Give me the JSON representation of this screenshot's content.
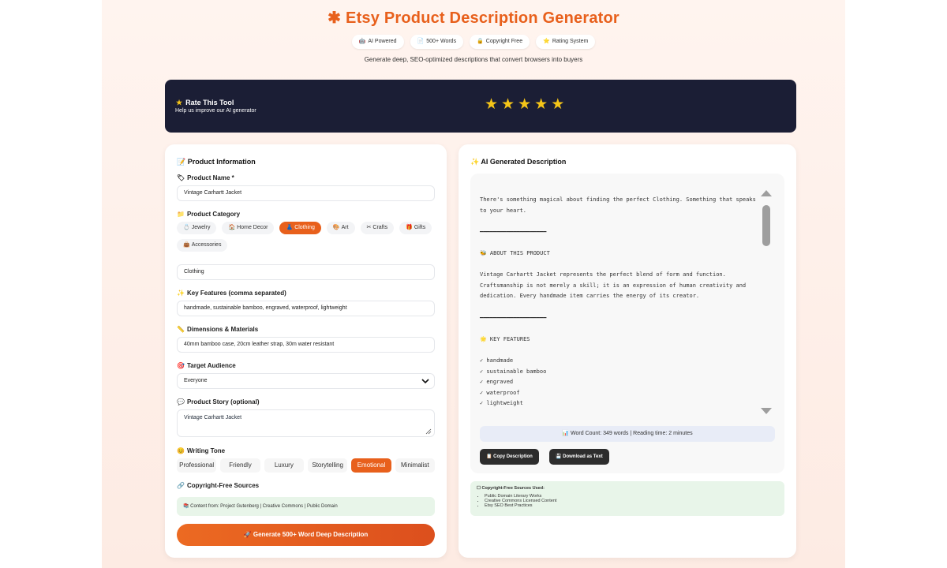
{
  "header": {
    "title": "Etsy Product Description Generator",
    "subtitle": "Generate deep, SEO-optimized descriptions that convert browsers into buyers",
    "badges": [
      {
        "icon": "🤖",
        "label": "AI Powered"
      },
      {
        "icon": "📄",
        "label": "500+ Words"
      },
      {
        "icon": "🔒",
        "label": "Copyright Free"
      },
      {
        "icon": "⭐",
        "label": "Rating System"
      }
    ]
  },
  "rating": {
    "title": "Rate This Tool",
    "subtitle": "Help us improve our AI generator",
    "stars": "★ ★ ★ ★ ★"
  },
  "form": {
    "heading": "Product Information",
    "product_name_label": "Product Name *",
    "product_name_value": "Vintage Carhartt Jacket",
    "category_label": "Product Category",
    "categories": [
      {
        "icon": "💍",
        "label": "Jewelry"
      },
      {
        "icon": "🏠",
        "label": "Home Decor"
      },
      {
        "icon": "👗",
        "label": "Clothing"
      },
      {
        "icon": "🎨",
        "label": "Art"
      },
      {
        "icon": "✂",
        "label": "Crafts"
      },
      {
        "icon": "🎁",
        "label": "Gifts"
      },
      {
        "icon": "👜",
        "label": "Accessories"
      }
    ],
    "selected_category": "Clothing",
    "category_value": "Clothing",
    "features_label": "Key Features (comma separated)",
    "features_value": "handmade, sustainable bamboo, engraved, waterproof, lightweight",
    "dimensions_label": "Dimensions & Materials",
    "dimensions_value": "40mm bamboo case, 20cm leather strap, 30m water resistant",
    "audience_label": "Target Audience",
    "audience_value": "Everyone",
    "story_label": "Product Story (optional)",
    "story_value": "Vintage Carhartt Jacket",
    "tone_label": "Writing Tone",
    "tones": [
      "Professional",
      "Friendly",
      "Luxury",
      "Storytelling",
      "Emotional",
      "Minimalist"
    ],
    "selected_tone": "Emotional",
    "sources_label": "Copyright-Free Sources",
    "sources_value": "Content from: Project Gutenberg | Creative Commons | Public Domain",
    "generate_label": "Generate 500+ Word Deep Description"
  },
  "output": {
    "heading": "AI Generated Description",
    "text": "There's something magical about finding the perfect Clothing. Something that speaks\nto your heart.\n\n━━━━━━━━━━━━━━━━━━━━\n\n🐝 ABOUT THIS PRODUCT\n\nVintage Carhartt Jacket represents the perfect blend of form and function.\nCraftsmanship is not merely a skill; it is an expression of human creativity and\ndedication. Every handmade item carries the energy of its creator.\n\n━━━━━━━━━━━━━━━━━━━━\n\n🌟 KEY FEATURES\n\n✓ handmade\n✓ sustainable bamboo\n✓ engraved\n✓ waterproof\n✓ lightweight",
    "word_count": "📊 Word Count: 349 words | Reading time: 2 minutes",
    "copy_label": "📋 Copy Description",
    "download_label": "💾 Download as Text",
    "sources_title": "Copyright-Free Sources Used:",
    "sources": [
      "Public Domain Literary Works",
      "Creative Commons Licensed Content",
      "Etsy SEO Best Practices"
    ]
  },
  "colors": {
    "accent": "#e8601c",
    "banner": "#1b1e35",
    "star": "#f5c518"
  }
}
